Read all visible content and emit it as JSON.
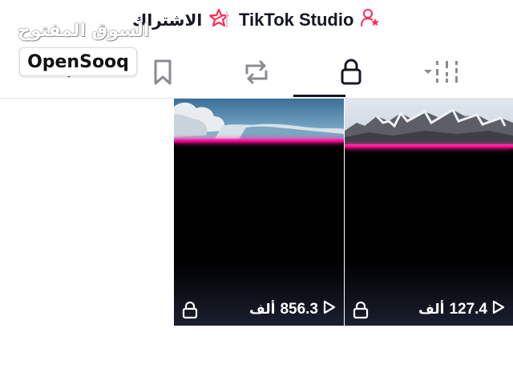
{
  "header": {
    "watermark_text": "السوق المفتوح",
    "subscription_label": "الاشتراك",
    "studio_label": "TikTok Studio",
    "accent_color": "#fe2c55"
  },
  "logo": {
    "text": "OpenSooq"
  },
  "tabs": [
    {
      "icon": "chevron-down-icon",
      "selected": false
    },
    {
      "icon": "bookmark-icon",
      "selected": false
    },
    {
      "icon": "repost-icon",
      "selected": false
    },
    {
      "icon": "lock-icon",
      "selected": true
    },
    {
      "icon": "filter-menu-icon",
      "selected": false
    }
  ],
  "videos": [
    {
      "views": "856.3",
      "unit": "ألف",
      "private": true,
      "icon": "play-icon"
    },
    {
      "views": "127.4",
      "unit": "ألف",
      "private": true,
      "icon": "play-icon"
    }
  ]
}
